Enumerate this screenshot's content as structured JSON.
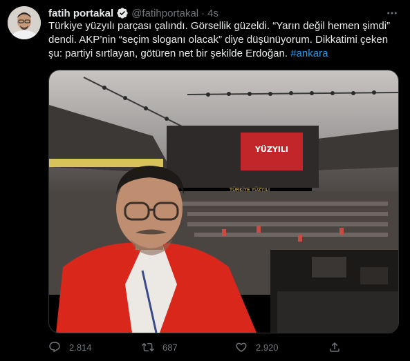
{
  "author": {
    "display_name": "fatih portakal",
    "handle": "@fatihportakal",
    "separator": "·",
    "timestamp": "4s",
    "verified": true
  },
  "tweet": {
    "text_lines": [
      "Türkiye yüzyılı parçası çalındı. Görsellik güzeldi. “Yarın değil hemen şimdi”",
      "dendi. AKP’nin “seçim sloganı olacak” diye düşünüyorum. Dikkatimi çeken",
      "şu: partiyi sırtlayan, götüren net bir şekilde Erdoğan."
    ],
    "hashtag": "#ankara"
  },
  "media": {
    "screen_text_1": "YÜZYILI",
    "screen_text_2": "TÜRKİYE YÜZYILI"
  },
  "actions": {
    "replies": "2.814",
    "retweets": "687",
    "likes": "2.920"
  },
  "colors": {
    "background": "#000000",
    "text": "#e7e9ea",
    "muted": "#71767b",
    "accent": "#1d9bf0"
  },
  "icons": [
    "more-icon",
    "verified-badge-icon",
    "reply-icon",
    "retweet-icon",
    "like-icon",
    "share-icon"
  ]
}
